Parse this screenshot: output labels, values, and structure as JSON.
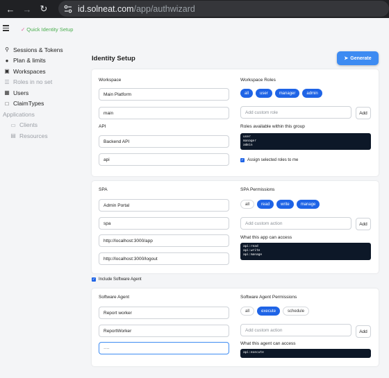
{
  "browser": {
    "url_host": "id.solneat.com",
    "url_path": "/app/authwizard"
  },
  "appbar": {
    "quick_setup": "Quick Identity Setup"
  },
  "sidebar": {
    "items": [
      {
        "label": "Sessions & Tokens",
        "icon": "key-icon"
      },
      {
        "label": "Plan & limits",
        "icon": "users-icon"
      },
      {
        "label": "Workspaces",
        "icon": "workspaces-icon"
      },
      {
        "label": "Roles in no set",
        "icon": "roles-icon"
      },
      {
        "label": "Users",
        "icon": "id-card-icon"
      },
      {
        "label": "ClaimTypes",
        "icon": "doc-icon"
      },
      {
        "label": "Applications",
        "icon": ""
      },
      {
        "label": "Clients",
        "icon": "monitor-icon"
      },
      {
        "label": "Resources",
        "icon": "server-icon"
      }
    ]
  },
  "page": {
    "title": "Identity Setup",
    "generate_label": "Generate"
  },
  "workspace_card": {
    "workspace_label": "Workspace",
    "workspace_name": "Main Platform",
    "workspace_slug": "main",
    "api_label": "API",
    "api_name": "Backend API",
    "api_slug": "api",
    "roles_label": "Workspace Roles",
    "roles": [
      "all",
      "user",
      "manager",
      "admin"
    ],
    "custom_role_placeholder": "Add custom role",
    "add_label": "Add",
    "roles_available_label": "Roles available within this group",
    "roles_available": [
      "user",
      "manager",
      "admin"
    ],
    "assign_label": "Assign selected roles to me"
  },
  "spa_card": {
    "spa_label": "SPA",
    "spa_name": "Admin Portal",
    "spa_slug": "spa",
    "redirect_url": "http://localhost:3000/app",
    "logout_url": "http://localhost:3000/logout",
    "permissions_label": "SPA Permissions",
    "permissions": [
      "all",
      "read",
      "write",
      "manage"
    ],
    "custom_action_placeholder": "Add custom action",
    "add_label": "Add",
    "access_label": "What this app can access",
    "access": [
      "api:read",
      "api:write",
      "api:manage"
    ]
  },
  "include_agent_label": "Include Software Agent",
  "agent_card": {
    "agent_label": "Software Agent",
    "agent_name": "Report worker",
    "agent_id": "ReportWorker",
    "agent_secret": "····",
    "permissions_label": "Software Agent Permissions",
    "permissions": [
      "all",
      "execute",
      "schedule"
    ],
    "custom_action_placeholder": "Add custom action",
    "add_label": "Add",
    "access_label": "What this agent can access",
    "access": [
      "api:execute"
    ]
  }
}
